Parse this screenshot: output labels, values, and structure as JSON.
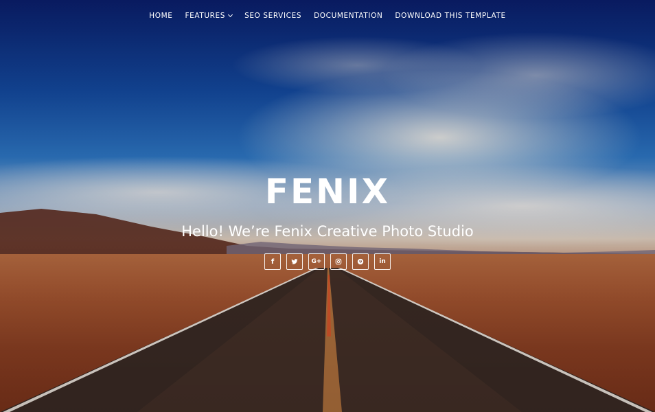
{
  "nav": {
    "items": [
      {
        "label": "HOME"
      },
      {
        "label": "FEATURES"
      },
      {
        "label": "SEO SERVICES"
      },
      {
        "label": "DOCUMENTATION"
      },
      {
        "label": "DOWNLOAD THIS TEMPLATE"
      }
    ]
  },
  "hero": {
    "brand": "FENIX",
    "tagline": "Hello! We’re Fenix Creative Photo Studio"
  },
  "social": {
    "icons": [
      "facebook-icon",
      "twitter-icon",
      "google-plus-icon",
      "instagram-icon",
      "pinterest-icon",
      "linkedin-icon"
    ],
    "facebook_glyph": "f",
    "google_glyph": "G+",
    "pinterest_glyph": "P",
    "linkedin_glyph": "in"
  },
  "colors": {
    "text": "#ffffff",
    "sky_top": "#0a1f6b",
    "ground": "#a0512e"
  }
}
